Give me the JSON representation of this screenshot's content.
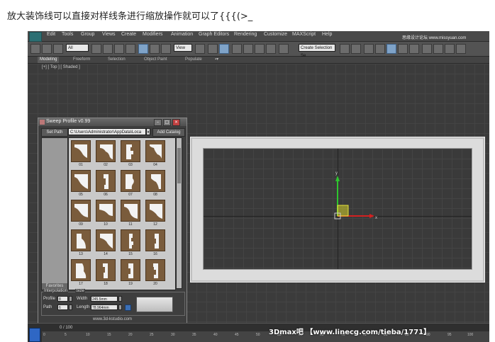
{
  "caption": "放大装饰线可以直接对样线条进行缩放操作就可以了{{{(>_",
  "menu": [
    "Edit",
    "Tools",
    "Group",
    "Views",
    "Create",
    "Modifiers",
    "Animation",
    "Graph Editors",
    "Rendering",
    "Customize",
    "MAXScript",
    "Help"
  ],
  "corner_watermark": "思缘设计论坛 www.missyuan.com",
  "toolbar": {
    "selection_filter": "All",
    "view": "View",
    "named_selection": "Create Selection Se"
  },
  "ribbon_tabs": [
    "Modeling",
    "Freeform",
    "Selection",
    "Object Paint",
    "Populate"
  ],
  "viewport_label": "[+] [ Top ] [ Shaded ]",
  "dialog": {
    "title": "Sweep Profile v0.99",
    "set_path": "Set Path",
    "path_value": "C:\\Users\\Administrator\\AppData\\Loca",
    "add_catalog": "Add Catalog",
    "side_label": "Favorites",
    "profiles": [
      "01",
      "02",
      "03",
      "04",
      "05",
      "06",
      "07",
      "08",
      "09",
      "10",
      "11",
      "12",
      "13",
      "14",
      "15",
      "16",
      "17",
      "18",
      "19",
      "20"
    ],
    "interpolation_label": "Interpolation",
    "profile_label": "Profile",
    "profile_value": "8",
    "path_label": "Path",
    "path_steps": "6",
    "size_label": "Size",
    "width_label": "Width",
    "width_value": "245.5mm",
    "length_label": "Length",
    "length_value": "78.964mm",
    "website": "www.3d-kstudio.com"
  },
  "timeline": {
    "frame_counter": "0 / 100",
    "ticks": [
      "0",
      "5",
      "10",
      "15",
      "20",
      "25",
      "30",
      "35",
      "40",
      "45",
      "50",
      "55",
      "60",
      "65",
      "70",
      "75",
      "80",
      "85",
      "90",
      "95",
      "100"
    ]
  },
  "watermark": "3Dmax吧  【www.linecg.com/tieba/1771】"
}
